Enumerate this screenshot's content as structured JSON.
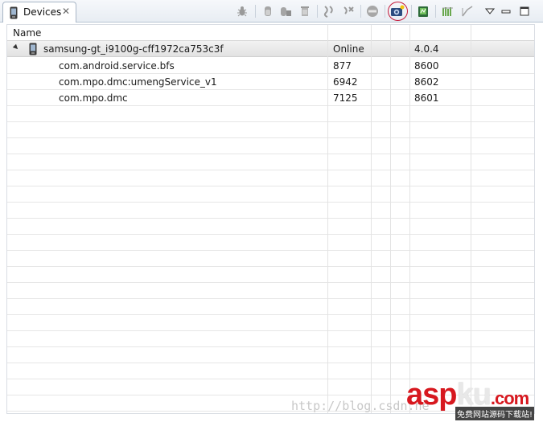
{
  "tab": {
    "title": "Devices",
    "close_glyph": "✕",
    "icon": "phone-icon"
  },
  "toolbar": {
    "buttons": [
      "debug-icon",
      "update-heap-icon",
      "dump-hprof-icon",
      "cause-gc-icon",
      "update-threads-icon",
      "start-method-profiling-icon",
      "stop-process-icon",
      "screen-capture-icon",
      "systrace-icon",
      "dump-view-hierarchy-icon",
      "capture-opengl-trace-icon",
      "view-menu-icon",
      "minimize-icon",
      "maximize-icon"
    ],
    "highlighted": "screen-capture-icon"
  },
  "table": {
    "columns": {
      "name": "Name",
      "c2": "",
      "c3": "",
      "c4": "",
      "c5": "",
      "c6": ""
    },
    "device": {
      "name": "samsung-gt_i9100g-cff1972ca753c3f",
      "status": "Online",
      "version": "4.0.4"
    },
    "processes": [
      {
        "name": "com.android.service.bfs",
        "pid": "877",
        "port": "8600"
      },
      {
        "name": "com.mpo.dmc:umengService_v1",
        "pid": "6942",
        "port": "8602"
      },
      {
        "name": "com.mpo.dmc",
        "pid": "7125",
        "port": "8601"
      }
    ]
  },
  "watermark": {
    "url": "http://blog.csdn.ne",
    "logo_a": "asp",
    "logo_b": "ku",
    "logo_c": ".com",
    "sub": "免费网站源码下载站!"
  },
  "colors": {
    "accent": "#c41a3a",
    "brand": "#d7181f"
  }
}
